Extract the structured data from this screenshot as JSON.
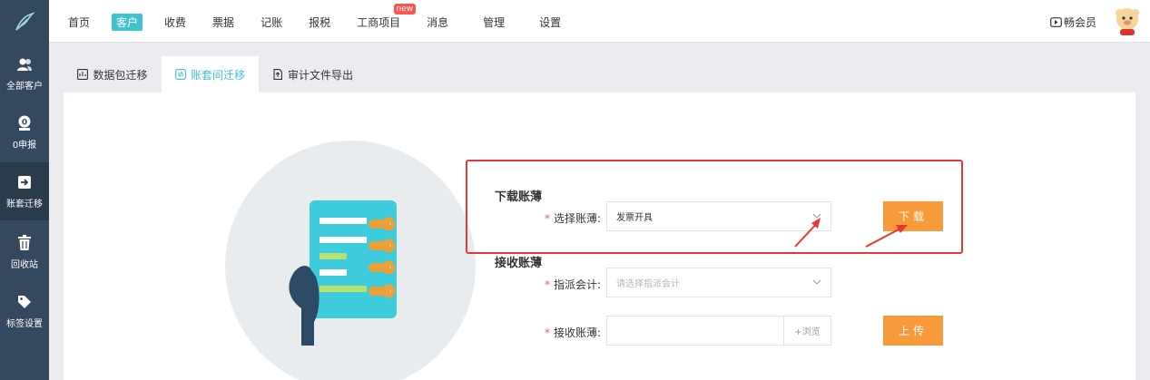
{
  "nav": {
    "items": [
      "首页",
      "客户",
      "收费",
      "票据",
      "记账",
      "报税",
      "工商项目",
      "消息",
      "管理",
      "设置"
    ],
    "active": "客户",
    "new_badge": "new",
    "vip_label": "畅会员"
  },
  "sidebar": {
    "items": [
      {
        "label": "全部客户",
        "icon": "users-icon"
      },
      {
        "label": "0申报",
        "icon": "zero-report-icon"
      },
      {
        "label": "账套迁移",
        "icon": "migrate-icon"
      },
      {
        "label": "回收站",
        "icon": "trash-icon"
      },
      {
        "label": "标签设置",
        "icon": "tag-icon"
      }
    ],
    "active": "账套迁移"
  },
  "tabs": [
    {
      "label": "数据包迁移",
      "icon": "data-package-icon"
    },
    {
      "label": "账套间迁移",
      "icon": "ledger-transfer-icon"
    },
    {
      "label": "审计文件导出",
      "icon": "export-file-icon"
    }
  ],
  "active_tab": "账套间迁移",
  "download": {
    "title": "下载账薄",
    "select_label": "选择账薄:",
    "select_value": "发票开具",
    "button_label": "下载"
  },
  "receive": {
    "title": "接收账薄",
    "assign_label": "指派会计:",
    "assign_placeholder": "请选择指派会计",
    "ledger_label": "接收账薄:",
    "browse_label": "+浏览",
    "upload_label": "上传"
  },
  "colors": {
    "accent": "#41c3cf",
    "sidebar": "#34495e",
    "button": "#f99a3a",
    "annotation": "#e53935"
  }
}
